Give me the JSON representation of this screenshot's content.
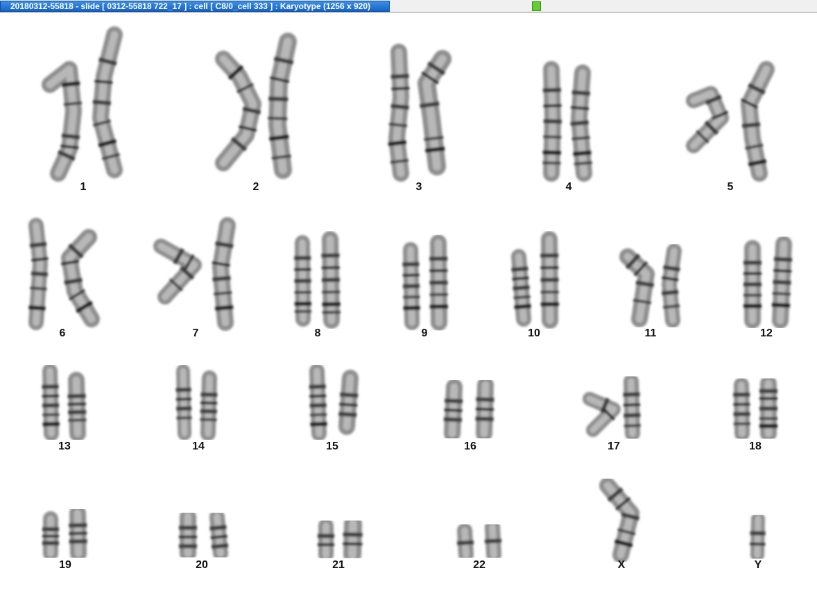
{
  "window": {
    "title": "20180312-55818 - slide [ 0312-55818 722_17 ] : cell [ C8/0_cell 333 ] : Karyotype  (1256 x 920)",
    "status_color": "#66cc33"
  },
  "karyotype": {
    "labels": [
      "1",
      "2",
      "3",
      "4",
      "5",
      "6",
      "7",
      "8",
      "9",
      "10",
      "11",
      "12",
      "13",
      "14",
      "15",
      "16",
      "17",
      "18",
      "19",
      "20",
      "21",
      "22",
      "X",
      "Y"
    ]
  }
}
